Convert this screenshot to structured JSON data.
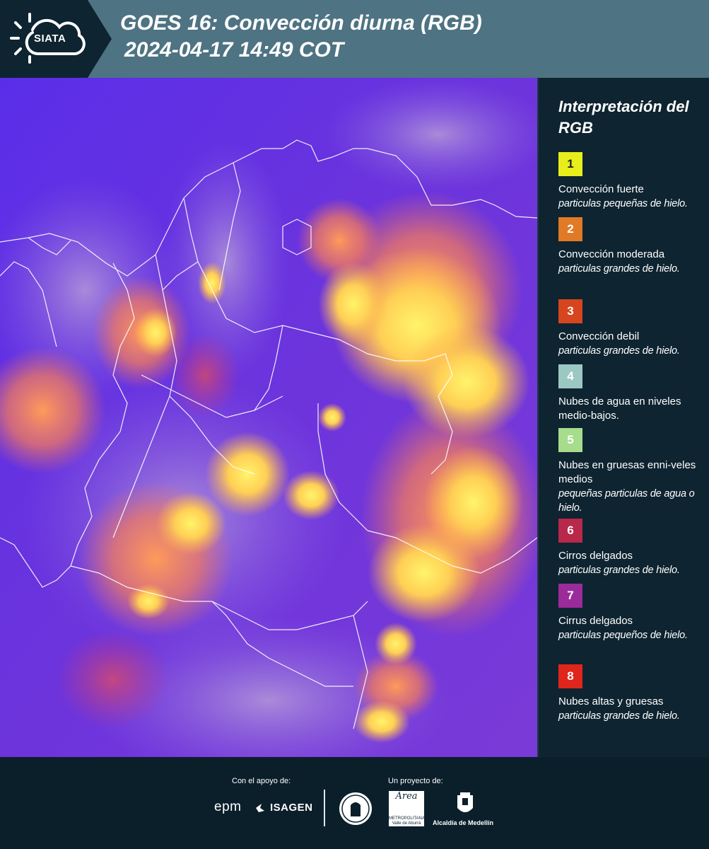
{
  "header": {
    "logo_text": "SIATA",
    "title": "GOES 16: Convección diurna (RGB)",
    "subtitle": "2024-04-17 14:49 COT"
  },
  "legend": {
    "title": "Interpretación del RGB",
    "items": [
      {
        "number": "1",
        "color": "#e8ee1c",
        "text_color": "#222222",
        "name": "Convección fuerte",
        "desc": "particulas pequeñas de hielo."
      },
      {
        "number": "2",
        "color": "#e07a26",
        "text_color": "#ffffff",
        "name": "Convección moderada",
        "desc": "particulas grandes de hielo."
      },
      {
        "number": "3",
        "color": "#d7451f",
        "text_color": "#ffffff",
        "name": "Convección debil",
        "desc": "particulas grandes de hielo."
      },
      {
        "number": "4",
        "color": "#9cc8c4",
        "text_color": "#ffffff",
        "name": "Nubes de agua en niveles medio-bajos.",
        "desc": ""
      },
      {
        "number": "5",
        "color": "#a6dc8c",
        "text_color": "#ffffff",
        "name": "Nubes en gruesas enni-veles medios",
        "desc": "pequeñas particulas de agua o hielo."
      },
      {
        "number": "6",
        "color": "#b8284a",
        "text_color": "#ffffff",
        "name": "Cirros delgados",
        "desc": "particulas grandes de hielo."
      },
      {
        "number": "7",
        "color": "#9b2b9a",
        "text_color": "#ffffff",
        "name": "Cirrus delgados",
        "desc": "particulas pequeños de hielo."
      },
      {
        "number": "8",
        "color": "#e0251c",
        "text_color": "#ffffff",
        "name": "Nubes altas y gruesas",
        "desc": "particulas grandes de hielo."
      }
    ]
  },
  "footer": {
    "support_label": "Con el apoyo de:",
    "project_label": "Un proyecto de:",
    "sponsor_epm": "epm",
    "sponsor_isagen": "ISAGEN",
    "area_logo_text": "Área",
    "area_logo_sub": "METROPOLITANA Valle de Aburrá",
    "alcaldia": "Alcaldía de Medellín"
  }
}
